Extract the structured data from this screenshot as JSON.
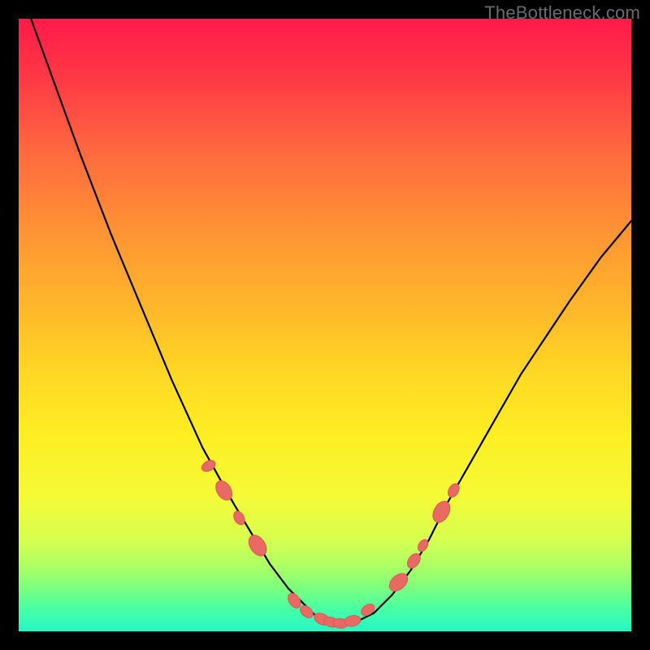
{
  "watermark": "TheBottleneck.com",
  "colors": {
    "background": "#000000",
    "gradient_top": "#ff1a49",
    "gradient_bottom": "#25f7c7",
    "curve": "#000000",
    "marker": "#e86a62"
  },
  "chart_data": {
    "type": "line",
    "title": "",
    "xlabel": "",
    "ylabel": "",
    "xlim": [
      0,
      100
    ],
    "ylim": [
      0,
      100
    ],
    "grid": false,
    "series": [
      {
        "name": "bottleneck-curve",
        "x": [
          2,
          6,
          10,
          15,
          20,
          25,
          30,
          35,
          38,
          41,
          44,
          47,
          49,
          51,
          53,
          55,
          58,
          61,
          64,
          67,
          70,
          74,
          78,
          82,
          86,
          90,
          95,
          100
        ],
        "y": [
          100,
          89,
          78,
          65,
          53,
          41,
          30,
          21,
          16,
          11,
          7,
          4,
          2,
          1.5,
          1.2,
          1.5,
          3,
          6,
          10,
          15,
          21,
          28,
          35,
          42,
          48,
          54,
          61,
          67
        ]
      }
    ],
    "markers": {
      "name": "highlight-points",
      "x": [
        31,
        33.5,
        36,
        39,
        45,
        47,
        49.5,
        51,
        52.5,
        54.5,
        57,
        62,
        64.5,
        66,
        69,
        71
      ],
      "y": [
        27,
        23,
        18.5,
        14,
        5,
        3.2,
        2,
        1.5,
        1.3,
        1.7,
        3.5,
        8,
        11.5,
        14,
        19.5,
        23
      ],
      "size_cycle": [
        9,
        13,
        9,
        14,
        10,
        9,
        10,
        9,
        9,
        10,
        9,
        13,
        10,
        8,
        14,
        9
      ]
    }
  }
}
